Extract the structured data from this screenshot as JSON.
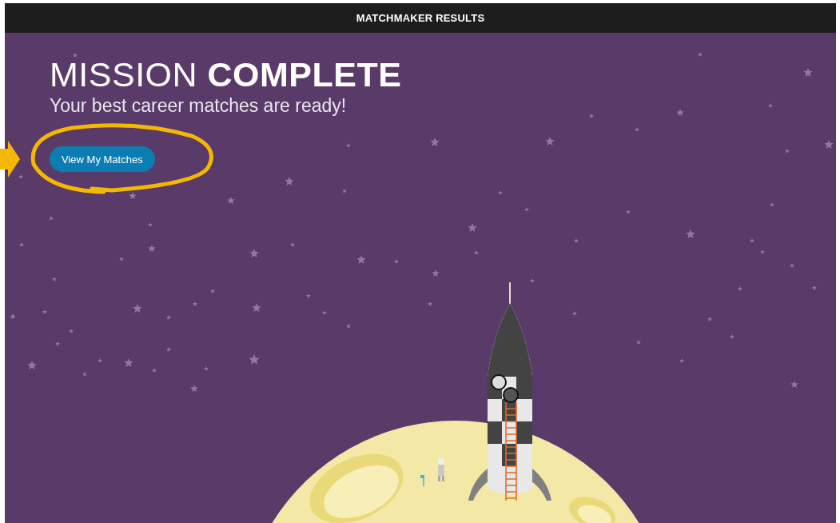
{
  "header": {
    "title": "MATCHMAKER RESULTS"
  },
  "hero": {
    "heading": "MISSION **COMPLETE**",
    "subtitle": "Your best career matches are ready!",
    "button": "View My Matches"
  }
}
